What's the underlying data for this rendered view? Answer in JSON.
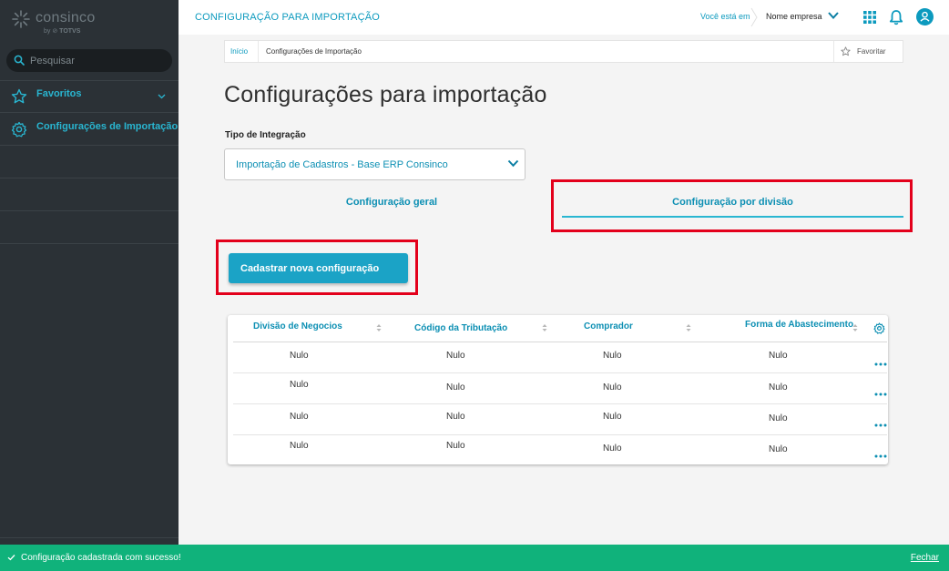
{
  "sidebar": {
    "logo": {
      "name": "consinco",
      "by": "by",
      "partner": "TOTVS"
    },
    "search": {
      "placeholder": "Pesquisar"
    },
    "items": [
      {
        "label": "Favoritos",
        "icon": "star-icon"
      },
      {
        "label": "Configurações de Importação",
        "icon": "gear-icon"
      }
    ]
  },
  "header": {
    "title": "CONFIGURAÇÃO PARA IMPORTAÇÃO",
    "you_are_in": "Você está em",
    "company": "Nome empresa"
  },
  "breadcrumb": {
    "home": "Início",
    "current": "Configurações de Importação",
    "favorite": "Favoritar"
  },
  "page": {
    "title": "Configurações para importação",
    "integration_label": "Tipo de Integração",
    "integration_value": "Importação de Cadastros - Base ERP Consinco"
  },
  "tabs": [
    {
      "label": "Configuração geral",
      "active": false
    },
    {
      "label": "Configuração por divisão",
      "active": true
    }
  ],
  "actions": {
    "new_config": "Cadastrar nova configuração"
  },
  "table": {
    "columns": [
      "Divisão de Negocios",
      "Código da Tributação",
      "Comprador",
      "Forma de Abastecimento"
    ],
    "rows": [
      [
        "Nulo",
        "Nulo",
        "Nulo",
        "Nulo"
      ],
      [
        "Nulo",
        "Nulo",
        "Nulo",
        "Nulo"
      ],
      [
        "Nulo",
        "Nulo",
        "Nulo",
        "Nulo"
      ],
      [
        "Nulo",
        "Nulo",
        "Nulo",
        "Nulo"
      ]
    ]
  },
  "toast": {
    "message": "Configuração cadastrada com sucesso!",
    "close": "Fechar"
  },
  "colors": {
    "accent": "#0c9abe",
    "primary_button": "#1ba3c6",
    "sidebar": "#2b3136",
    "success": "#10b27b",
    "highlight": "#e3001b"
  }
}
